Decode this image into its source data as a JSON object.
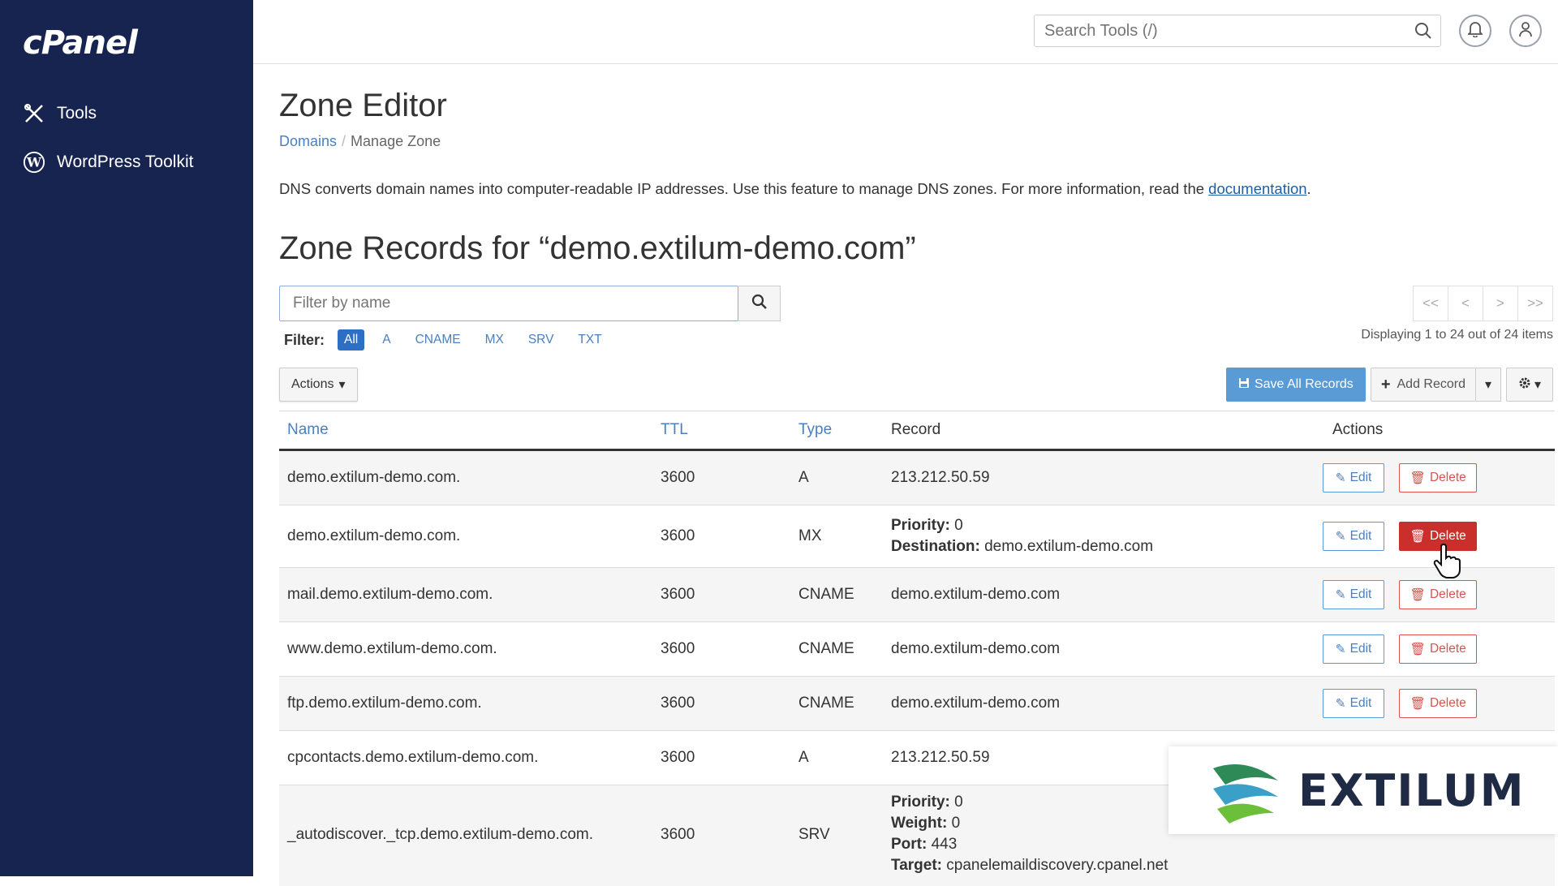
{
  "app": {
    "logo_text": "cPanel"
  },
  "sidebar": {
    "items": [
      {
        "label": "Tools",
        "icon": "tools-icon"
      },
      {
        "label": "WordPress Toolkit",
        "icon": "wordpress-icon"
      }
    ]
  },
  "topbar": {
    "search_placeholder": "Search Tools (/)"
  },
  "page": {
    "title": "Zone Editor",
    "breadcrumb": {
      "link": "Domains",
      "current": "Manage Zone"
    },
    "description": "DNS converts domain names into computer-readable IP addresses. Use this feature to manage DNS zones. For more information, read the ",
    "description_link": "documentation",
    "description_end": ".",
    "zone_title": "Zone Records for “demo.extilum-demo.com”"
  },
  "filter": {
    "placeholder": "Filter by name",
    "label": "Filter:",
    "chips": [
      "All",
      "A",
      "CNAME",
      "MX",
      "SRV",
      "TXT"
    ],
    "active": "All"
  },
  "pager": {
    "first": "<<",
    "prev": "<",
    "next": ">",
    "last": ">>",
    "display_text": "Displaying 1 to 24 out of 24 items"
  },
  "toolbar": {
    "actions_label": "Actions",
    "save_label": "Save All Records",
    "add_label": "Add Record"
  },
  "table": {
    "headers": {
      "name": "Name",
      "ttl": "TTL",
      "type": "Type",
      "record": "Record",
      "actions": "Actions"
    },
    "edit_label": "Edit",
    "delete_label": "Delete",
    "rows": [
      {
        "name": "demo.extilum-demo.com.",
        "ttl": "3600",
        "type": "A",
        "record": "213.212.50.59"
      },
      {
        "name": "demo.extilum-demo.com.",
        "ttl": "3600",
        "type": "MX",
        "priority_label": "Priority:",
        "priority": "0",
        "destination_label": "Destination:",
        "destination": "demo.extilum-demo.com"
      },
      {
        "name": "mail.demo.extilum-demo.com.",
        "ttl": "3600",
        "type": "CNAME",
        "record": "demo.extilum-demo.com"
      },
      {
        "name": "www.demo.extilum-demo.com.",
        "ttl": "3600",
        "type": "CNAME",
        "record": "demo.extilum-demo.com"
      },
      {
        "name": "ftp.demo.extilum-demo.com.",
        "ttl": "3600",
        "type": "CNAME",
        "record": "demo.extilum-demo.com"
      },
      {
        "name": "cpcontacts.demo.extilum-demo.com.",
        "ttl": "3600",
        "type": "A",
        "record": "213.212.50.59"
      },
      {
        "name": "_autodiscover._tcp.demo.extilum-demo.com.",
        "ttl": "3600",
        "type": "SRV",
        "priority_label": "Priority:",
        "priority": "0",
        "weight_label": "Weight:",
        "weight": "0",
        "port_label": "Port:",
        "port": "443",
        "target_label": "Target:",
        "target": "cpanelemaildiscovery.cpanel.net"
      }
    ]
  },
  "watermark": {
    "text": "EXTILUM"
  },
  "colors": {
    "sidebar": "#17244f",
    "primary": "#2d6fc4",
    "danger": "#d9534f"
  }
}
